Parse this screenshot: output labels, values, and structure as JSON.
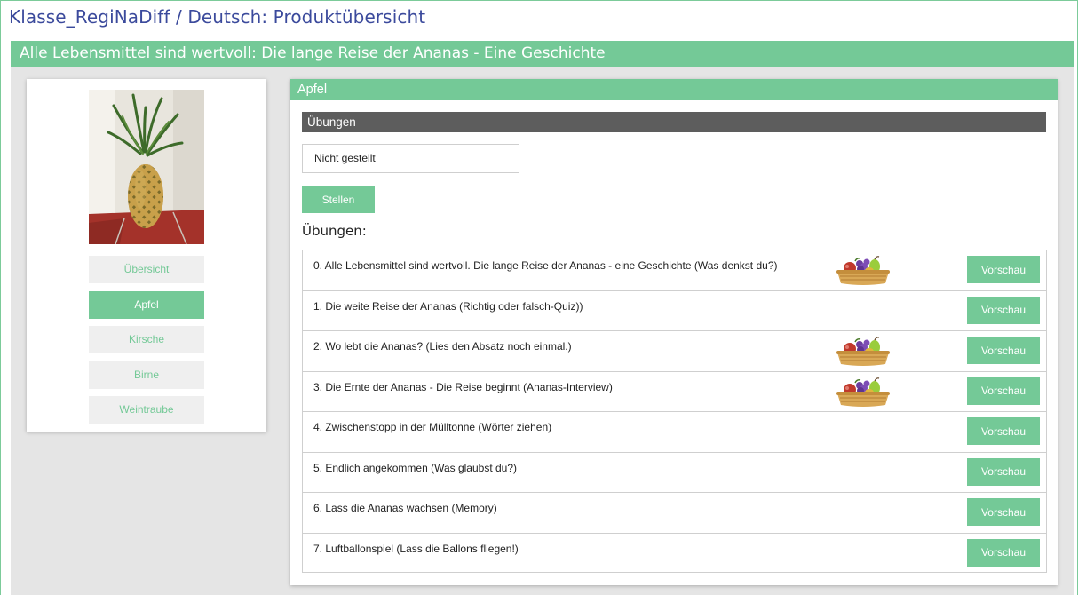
{
  "page": {
    "title": "Klasse_RegiNaDiff / Deutsch: Produktübersicht",
    "banner": "Alle Lebensmittel sind wertvoll: Die lange Reise der Ananas - Eine Geschichte"
  },
  "sidebar": {
    "image": "pineapple-photo",
    "items": [
      {
        "label": "Übersicht",
        "active": false
      },
      {
        "label": "Apfel",
        "active": true
      },
      {
        "label": "Kirsche",
        "active": false
      },
      {
        "label": "Birne",
        "active": false
      },
      {
        "label": "Weintraube",
        "active": false
      }
    ]
  },
  "main": {
    "section_title": "Apfel",
    "sub_header": "Übungen",
    "status_value": "Nicht gestellt",
    "stellen_label": "Stellen",
    "list_heading": "Übungen:",
    "exercises": [
      {
        "title": "0. Alle Lebensmittel sind wertvoll. Die lange Reise der Ananas - eine Geschichte (Was denkst du?)",
        "basket": true,
        "button": "Vorschau"
      },
      {
        "title": "1. Die weite Reise der Ananas (Richtig oder falsch-Quiz))",
        "basket": false,
        "button": "Vorschau"
      },
      {
        "title": "2. Wo lebt die Ananas? (Lies den Absatz noch einmal.)",
        "basket": true,
        "button": "Vorschau"
      },
      {
        "title": "3. Die Ernte der Ananas - Die Reise beginnt (Ananas-Interview)",
        "basket": true,
        "button": "Vorschau"
      },
      {
        "title": "4. Zwischenstopp in der Mülltonne (Wörter ziehen)",
        "basket": false,
        "button": "Vorschau"
      },
      {
        "title": "5. Endlich angekommen (Was glaubst du?)",
        "basket": false,
        "button": "Vorschau"
      },
      {
        "title": "6. Lass die Ananas wachsen (Memory)",
        "basket": false,
        "button": "Vorschau"
      },
      {
        "title": "7. Luftballonspiel (Lass die Ballons fliegen!)",
        "basket": false,
        "button": "Vorschau"
      }
    ]
  },
  "icons": {
    "basket": "fruit-basket-icon"
  },
  "colors": {
    "accent": "#74c997",
    "title": "#3b4a9c",
    "dark_header": "#5d5d5d",
    "background": "#e5e5e5"
  }
}
